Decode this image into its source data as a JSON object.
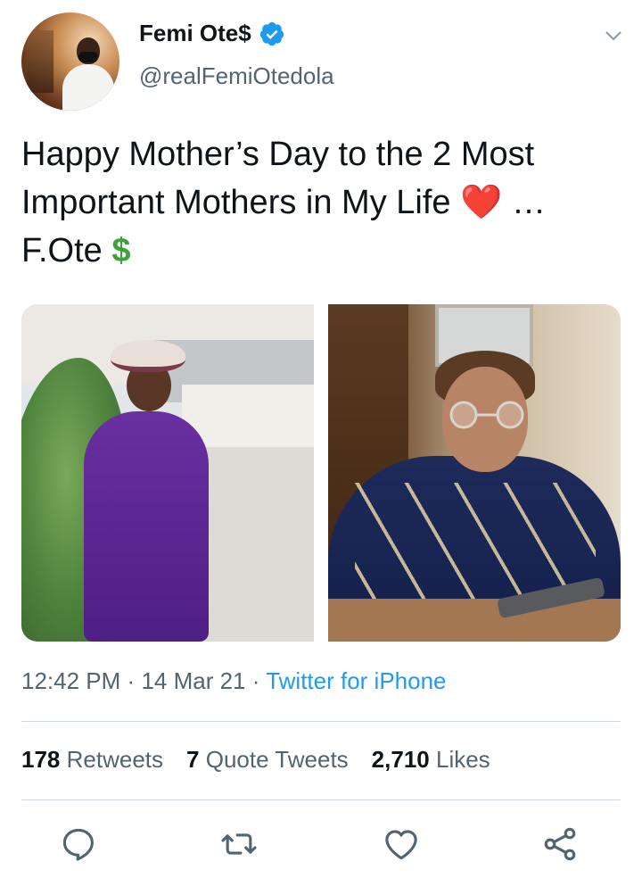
{
  "user": {
    "name": "Femi Ote$",
    "handle": "@realFemiOtedola"
  },
  "tweet": {
    "text_line1": "Happy Mother’s Day to the 2 Most",
    "text_line2": "Important Mothers in My Life",
    "text_line2_suffix": "…",
    "text_line3": "F.Ote",
    "heart_emoji": "❤️",
    "dollar_emoji": "$"
  },
  "meta": {
    "time": "12:42 PM",
    "date": "14 Mar 21",
    "source": "Twitter for iPhone",
    "separator": "·"
  },
  "stats": {
    "retweets_count": "178",
    "retweets_label": "Retweets",
    "quotes_count": "7",
    "quotes_label": "Quote Tweets",
    "likes_count": "2,710",
    "likes_label": "Likes"
  },
  "colors": {
    "link": "#1d9bf0",
    "secondary_text": "#536471",
    "primary_text": "#0f1419"
  },
  "icons": [
    "verified-icon",
    "chevron-down-icon",
    "reply-icon",
    "retweet-icon",
    "like-icon",
    "share-icon"
  ]
}
